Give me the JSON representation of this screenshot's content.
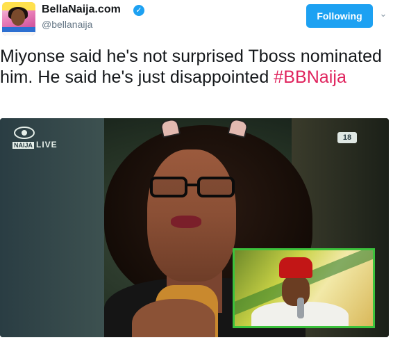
{
  "account": {
    "display_name": "BellaNaija.com",
    "handle": "@bellanaija",
    "verified_icon": "verified-badge-icon",
    "verified_glyph": "✓",
    "follow_button_label": "Following",
    "menu_icon": "chevron-down-icon",
    "menu_glyph": "⌄"
  },
  "tweet": {
    "text": "Miyonse said he's not surprised Tboss nominated him. He said he's just disappointed ",
    "hashtag": "#BBNaija",
    "hashtag_color": "#e0245e"
  },
  "media": {
    "overlay_live_label": "LIVE",
    "overlay_show_label": "NAIJA",
    "age_rating": "18"
  },
  "colors": {
    "follow_button": "#1da1f2",
    "text": "#14171a",
    "handle": "#657786",
    "pip_border": "#3cc23c"
  }
}
